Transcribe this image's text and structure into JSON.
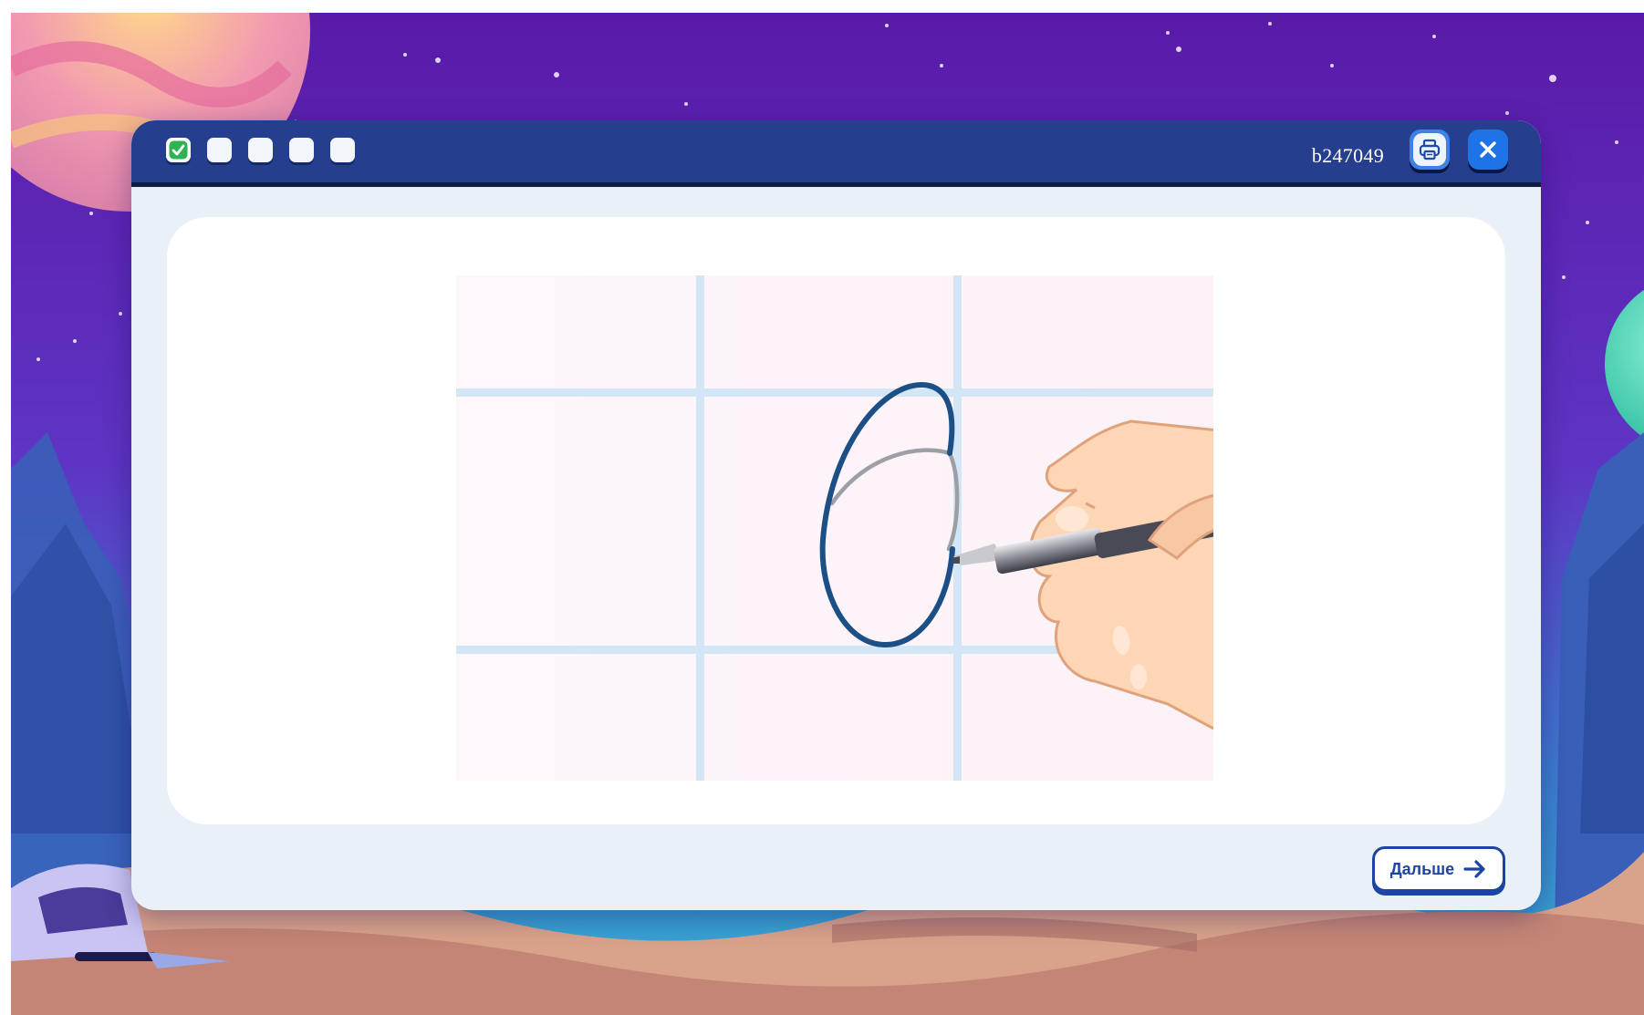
{
  "header": {
    "task_id": "b247049",
    "steps": [
      {
        "state": "done"
      },
      {
        "state": "pending"
      },
      {
        "state": "pending"
      },
      {
        "state": "pending"
      },
      {
        "state": "pending"
      }
    ],
    "print_icon": "printer-icon",
    "close_icon": "close-icon"
  },
  "exercise": {
    "digit": "6",
    "icon_names": [
      "digit-six-tracing-icon",
      "hand-holding-pen-icon"
    ]
  },
  "footer": {
    "next_label": "Дальше",
    "next_icon": "arrow-right-icon"
  },
  "colors": {
    "titlebar": "#253f8e",
    "accent": "#1c44a3",
    "digit_stroke": "#1c4f85",
    "grid": "#d3e6f6",
    "check": "#2fb350"
  }
}
